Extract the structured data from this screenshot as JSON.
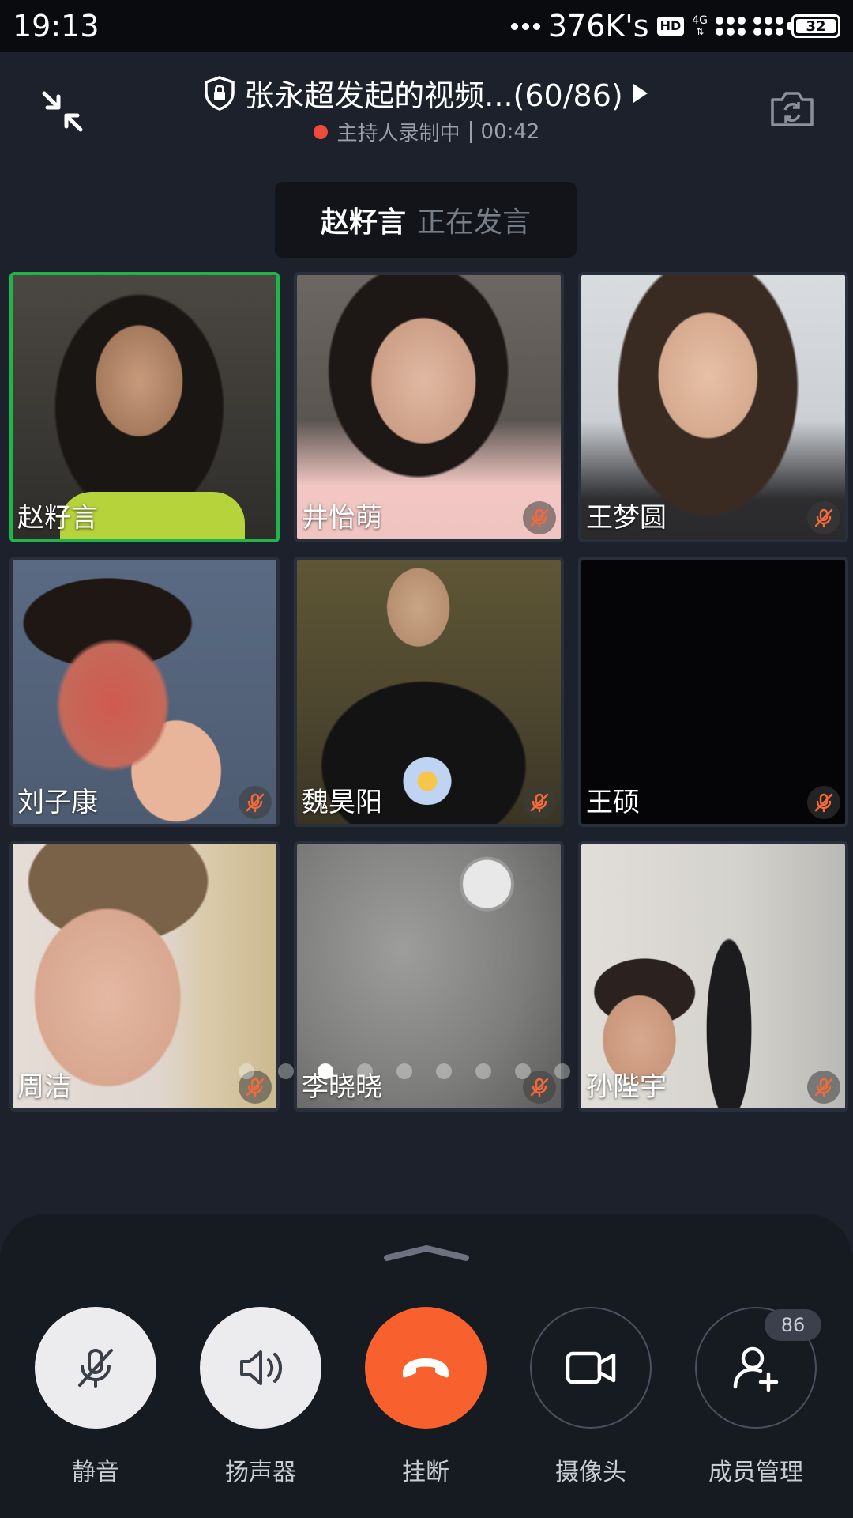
{
  "status_bar": {
    "time": "19:13",
    "network_speed": "376K's",
    "hd": "HD",
    "network_type": "4G",
    "battery": "32"
  },
  "header": {
    "title": "张永超发起的视频...(60/86)",
    "recording_status": "主持人录制中",
    "duration": "00:42"
  },
  "speaker": {
    "name": "赵籽言",
    "status": "正在发言"
  },
  "participants": [
    {
      "name": "赵籽言",
      "muted": false,
      "active": true
    },
    {
      "name": "井怡萌",
      "muted": true
    },
    {
      "name": "王梦圆",
      "muted": true
    },
    {
      "name": "刘子康",
      "muted": true
    },
    {
      "name": "魏昊阳",
      "muted": true
    },
    {
      "name": "王硕",
      "muted": true
    },
    {
      "name": "周洁",
      "muted": true
    },
    {
      "name": "李晓晓",
      "muted": true
    },
    {
      "name": "孙陛宇",
      "muted": true
    }
  ],
  "pagination": {
    "current": 3,
    "total": 9
  },
  "controls": [
    {
      "label": "静音",
      "icon": "mic-off-icon"
    },
    {
      "label": "扬声器",
      "icon": "speaker-icon"
    },
    {
      "label": "挂断",
      "icon": "hang-up-icon"
    },
    {
      "label": "摄像头",
      "icon": "video-camera-icon"
    },
    {
      "label": "成员管理",
      "icon": "add-member-icon"
    }
  ],
  "member_count_badge": "86",
  "colors": {
    "background": "#1c212b",
    "active_border": "#1fb54a",
    "hangup": "#f8612d",
    "record_dot": "#f04a3c"
  }
}
